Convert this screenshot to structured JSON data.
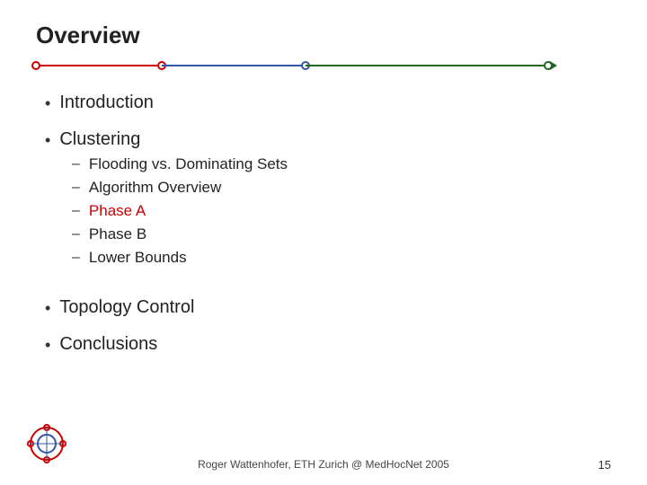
{
  "title": "Overview",
  "timeline": {
    "segments": [
      "red",
      "blue",
      "green"
    ]
  },
  "bullets": [
    {
      "text": "Introduction",
      "subitems": []
    },
    {
      "text": "Clustering",
      "subitems": [
        {
          "text": "Flooding vs. Dominating Sets",
          "highlight": false
        },
        {
          "text": "Algorithm Overview",
          "highlight": false
        },
        {
          "text": "Phase A",
          "highlight": true
        },
        {
          "text": "Phase B",
          "highlight": false
        },
        {
          "text": "Lower Bounds",
          "highlight": false
        }
      ]
    },
    {
      "text": "Topology Control",
      "subitems": []
    },
    {
      "text": "Conclusions",
      "subitems": []
    }
  ],
  "footer": {
    "text": "Roger Wattenhofer, ETH Zurich @ MedHocNet 2005",
    "page": "15"
  }
}
